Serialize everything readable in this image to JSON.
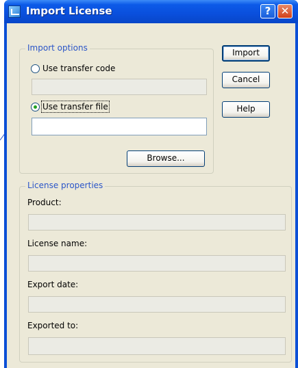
{
  "window": {
    "title": "Import License",
    "help_glyph": "?",
    "close_glyph": "✕"
  },
  "import_options": {
    "group_label": "Import options",
    "transfer_code_label": "Use transfer code",
    "transfer_code_value": "",
    "transfer_file_label": "Use transfer file",
    "transfer_file_value": "",
    "selected": "transfer_file",
    "browse_label": "Browse..."
  },
  "buttons": {
    "import_label": "Import",
    "cancel_label": "Cancel",
    "help_label": "Help"
  },
  "license_properties": {
    "group_label": "License properties",
    "product_label": "Product:",
    "product_value": "",
    "license_name_label": "License name:",
    "license_name_value": "",
    "export_date_label": "Export date:",
    "export_date_value": "",
    "exported_to_label": "Exported to:",
    "exported_to_value": ""
  },
  "colors": {
    "titlebar": "#0a4fdc",
    "client_bg": "#ece9d8",
    "group_label": "#2a55c8"
  }
}
